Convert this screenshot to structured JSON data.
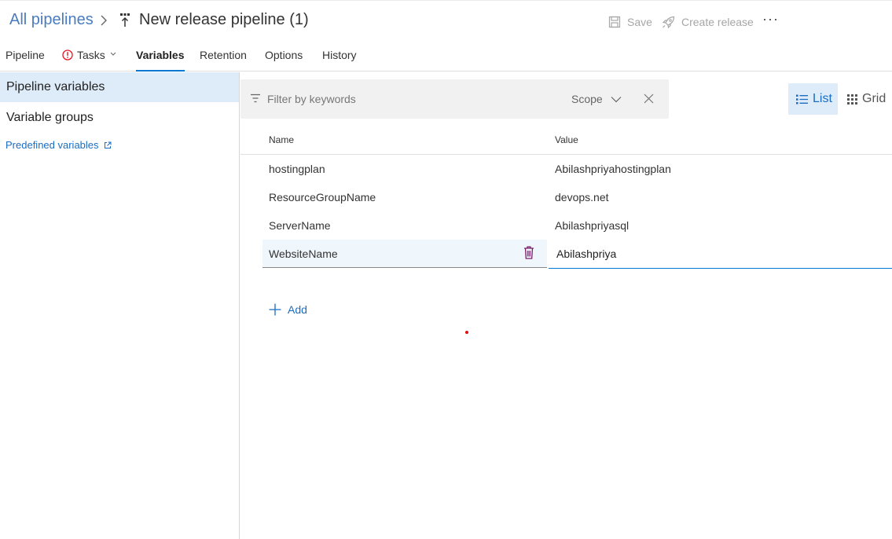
{
  "header": {
    "breadcrumb": "All pipelines",
    "title": "New release pipeline (1)",
    "save_label": "Save",
    "create_release_label": "Create release",
    "more_label": "···"
  },
  "tabs": [
    {
      "label": "Pipeline"
    },
    {
      "label": "Tasks"
    },
    {
      "label": "Variables"
    },
    {
      "label": "Retention"
    },
    {
      "label": "Options"
    },
    {
      "label": "History"
    }
  ],
  "active_tab": "Variables",
  "sidebar": {
    "items": [
      {
        "label": "Pipeline variables"
      },
      {
        "label": "Variable groups"
      }
    ],
    "predefined_link": "Predefined variables"
  },
  "filter": {
    "placeholder": "Filter by keywords",
    "scope_label": "Scope"
  },
  "view": {
    "list_label": "List",
    "grid_label": "Grid"
  },
  "table": {
    "headers": {
      "name": "Name",
      "value": "Value"
    },
    "rows": [
      {
        "name": "hostingplan",
        "value": "Abilashpriyahostingplan"
      },
      {
        "name": "ResourceGroupName",
        "value": "devops.net"
      },
      {
        "name": "ServerName",
        "value": "Abilashpriyasql"
      },
      {
        "name": "WebsiteName",
        "value": "Abilashpriya"
      }
    ]
  },
  "add_label": "Add",
  "colors": {
    "accent": "#0078d4",
    "link": "#1a6dc0",
    "selected_bg": "#deecf9",
    "warning": "#e81123",
    "delete_icon": "#7a1f6b"
  }
}
